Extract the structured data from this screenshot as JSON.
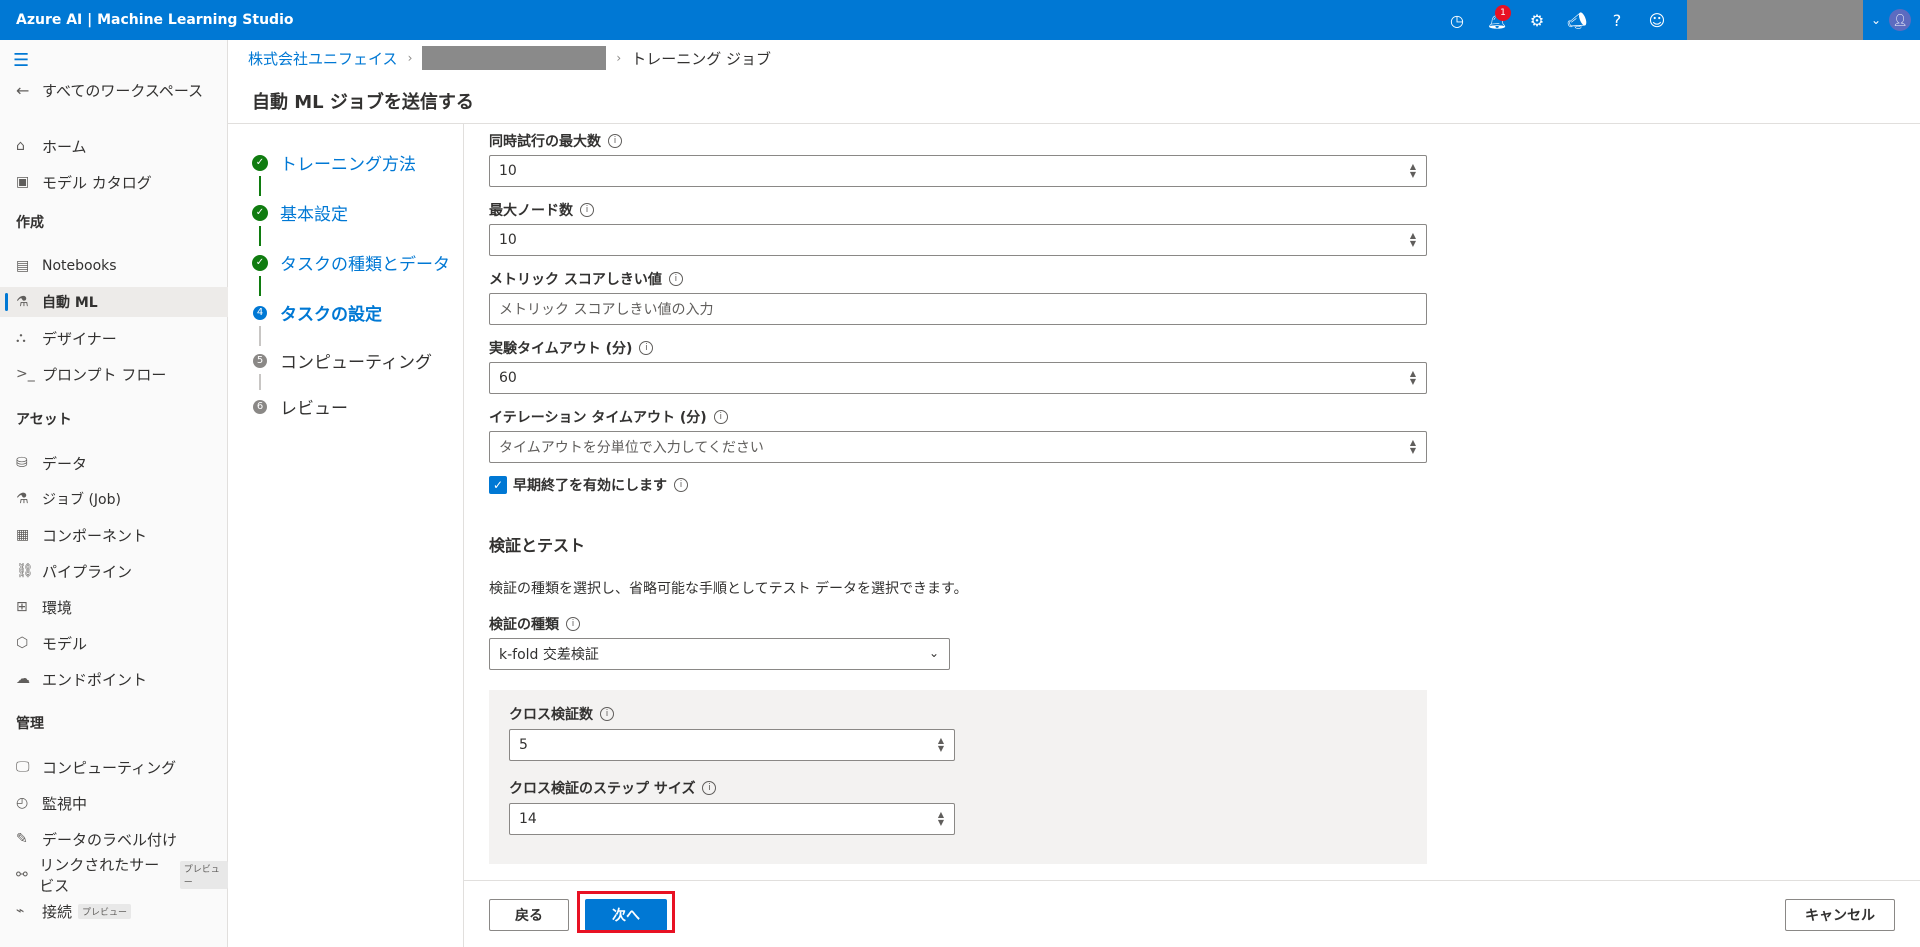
{
  "topbar": {
    "title": "Azure AI | Machine Learning Studio",
    "notification_count": "1",
    "icons": [
      "history-icon",
      "bell-icon",
      "gear-icon",
      "megaphone-icon",
      "help-icon",
      "smiley-icon",
      "chevron-down-icon",
      "avatar-icon"
    ],
    "accent": "#0078d4"
  },
  "nav": {
    "back_label": "すべてのワークスペース",
    "items_top": [
      {
        "label": "ホーム",
        "icon": "home-icon"
      },
      {
        "label": "モデル カタログ",
        "icon": "catalog-icon"
      }
    ],
    "section_create": "作成",
    "items_create": [
      {
        "label": "Notebooks",
        "icon": "notebook-icon"
      },
      {
        "label": "自動 ML",
        "icon": "automl-icon",
        "active": true
      },
      {
        "label": "デザイナー",
        "icon": "designer-icon"
      },
      {
        "label": "プロンプト フロー",
        "icon": "prompt-flow-icon"
      }
    ],
    "section_assets": "アセット",
    "items_assets": [
      {
        "label": "データ",
        "icon": "data-icon"
      },
      {
        "label": "ジョブ (Job)",
        "icon": "flask-icon"
      },
      {
        "label": "コンポーネント",
        "icon": "component-icon"
      },
      {
        "label": "パイプライン",
        "icon": "pipeline-icon"
      },
      {
        "label": "環境",
        "icon": "environment-icon"
      },
      {
        "label": "モデル",
        "icon": "cube-icon"
      },
      {
        "label": "エンドポイント",
        "icon": "endpoint-icon"
      }
    ],
    "section_manage": "管理",
    "items_manage": [
      {
        "label": "コンピューティング",
        "icon": "monitor-icon"
      },
      {
        "label": "監視中",
        "icon": "gauge-icon"
      },
      {
        "label": "データのラベル付け",
        "icon": "label-icon"
      },
      {
        "label": "リンクされたサービス",
        "icon": "link-icon",
        "tag": "プレビュー"
      },
      {
        "label": "接続",
        "icon": "plug-icon",
        "tag": "プレビュー"
      }
    ]
  },
  "breadcrumb": {
    "org": "株式会社ユニフェイス",
    "current": "トレーニング ジョブ"
  },
  "page_title": "自動 ML ジョブを送信する",
  "steps": [
    {
      "label": "トレーニング方法",
      "state": "done"
    },
    {
      "label": "基本設定",
      "state": "done"
    },
    {
      "label": "タスクの種類とデータ",
      "state": "done"
    },
    {
      "label": "タスクの設定",
      "state": "current",
      "num": "4"
    },
    {
      "label": "コンピューティング",
      "state": "todo",
      "num": "5"
    },
    {
      "label": "レビュー",
      "state": "todo",
      "num": "6"
    }
  ],
  "form": {
    "max_concurrent_label": "同時試行の最大数",
    "max_concurrent_value": "10",
    "max_nodes_label": "最大ノード数",
    "max_nodes_value": "10",
    "metric_threshold_label": "メトリック スコアしきい値",
    "metric_threshold_placeholder": "メトリック スコアしきい値の入力",
    "exp_timeout_label": "実験タイムアウト (分)",
    "exp_timeout_value": "60",
    "iter_timeout_label": "イテレーション タイムアウト (分)",
    "iter_timeout_placeholder": "タイムアウトを分単位で入力してください",
    "early_stop_label": "早期終了を有効にします",
    "early_stop_checked": true,
    "validation_section_title": "検証とテスト",
    "validation_desc": "検証の種類を選択し、省略可能な手順としてテスト データを選択できます。",
    "validation_type_label": "検証の種類",
    "validation_type_value": "k-fold 交差検証",
    "cv_count_label": "クロス検証数",
    "cv_count_value": "5",
    "cv_step_label": "クロス検証のステップ サイズ",
    "cv_step_value": "14"
  },
  "footer": {
    "back_label": "戻る",
    "next_label": "次へ",
    "cancel_label": "キャンセル",
    "highlight_color": "#e81123"
  }
}
